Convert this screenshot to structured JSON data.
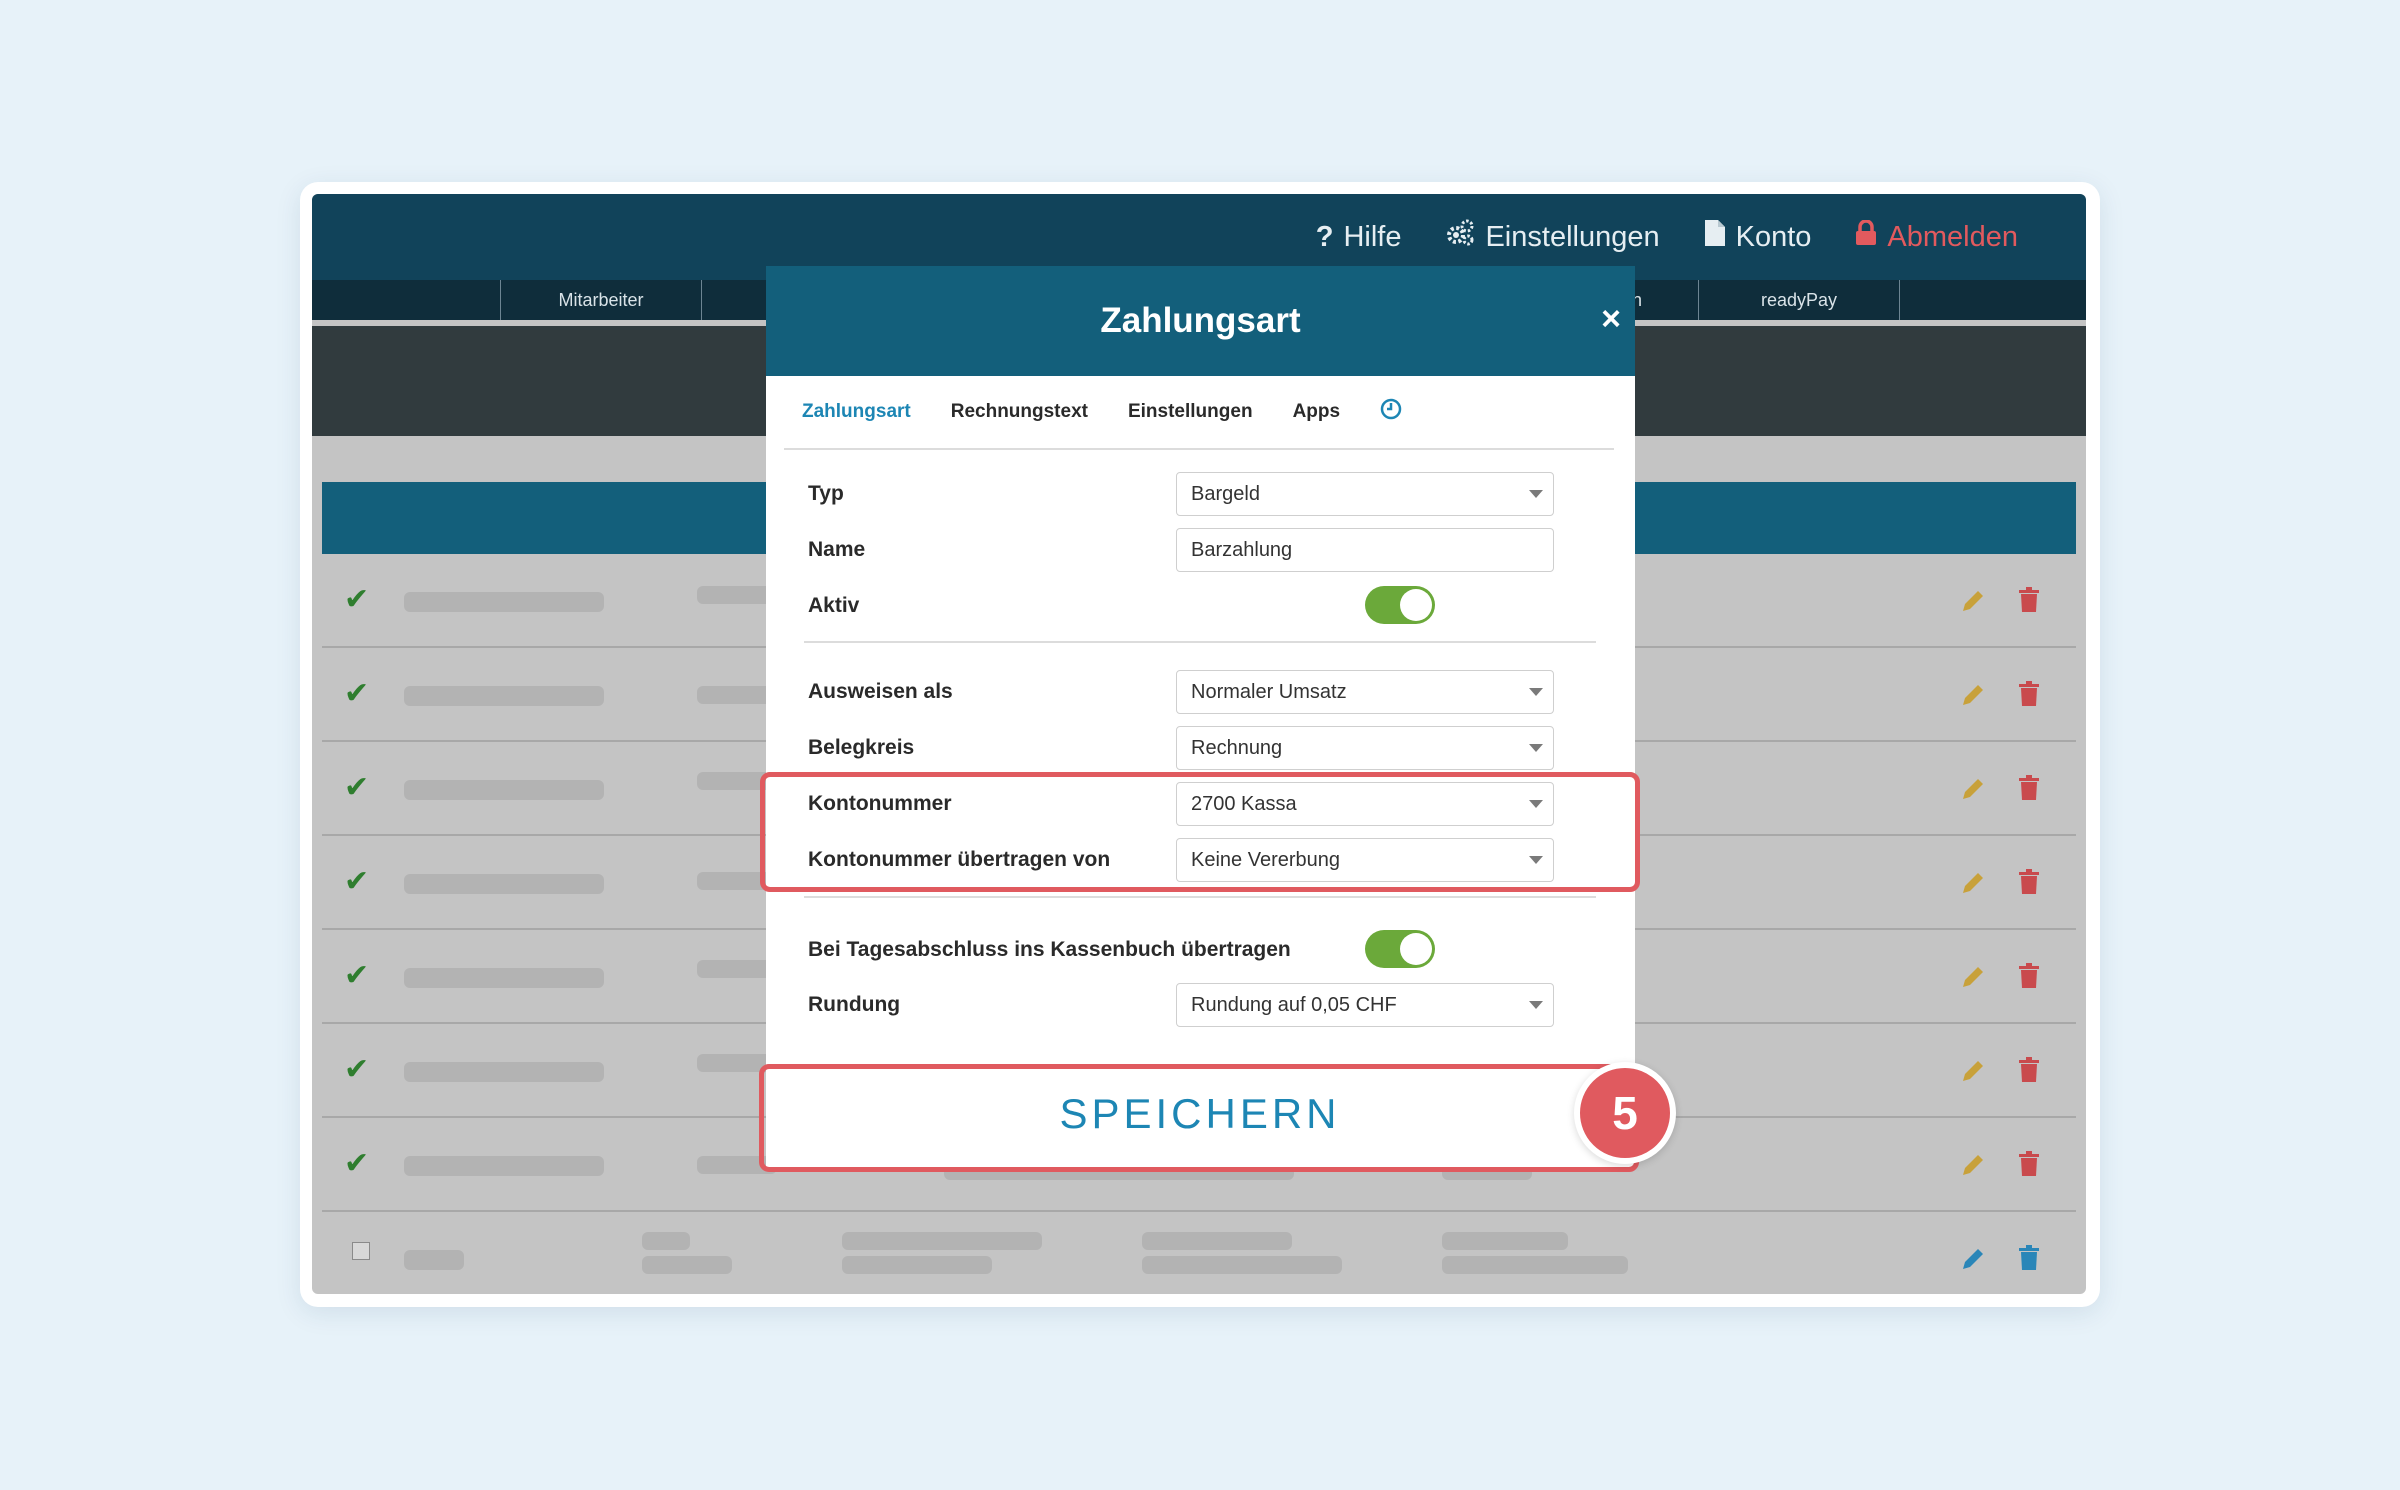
{
  "topnav": {
    "help": "Hilfe",
    "settings": "Einstellungen",
    "account": "Konto",
    "logout": "Abmelden"
  },
  "menubar": {
    "tab_employees": "Mitarbeiter",
    "tab_partial": "en",
    "tab_readypay": "readyPay"
  },
  "modal": {
    "title": "Zahlungsart",
    "close": "×",
    "tabs": [
      "Zahlungsart",
      "Rechnungstext",
      "Einstellungen",
      "Apps"
    ],
    "clock_icon": "clock-icon",
    "fields": {
      "typ_label": "Typ",
      "typ_value": "Bargeld",
      "name_label": "Name",
      "name_value": "Barzahlung",
      "aktiv_label": "Aktiv",
      "aktiv_on": true,
      "ausweisen_label": "Ausweisen als",
      "ausweisen_value": "Normaler Umsatz",
      "belegkreis_label": "Belegkreis",
      "belegkreis_value": "Rechnung",
      "konto_label": "Kontonummer",
      "konto_value": "2700 Kassa",
      "konto_uebertragen_label": "Kontonummer übertragen von",
      "konto_uebertragen_value": "Keine Vererbung",
      "kassenbuch_label": "Bei Tagesabschluss ins Kassenbuch übertragen",
      "kassenbuch_on": true,
      "rundung_label": "Rundung",
      "rundung_value": "Rundung auf 0,05 CHF"
    },
    "save_label": "SPEICHERN"
  },
  "step_number": "5",
  "colors": {
    "header": "#135f7b",
    "accent": "#1d86b4",
    "highlight": "#e05a5f",
    "toggle_on": "#6ba93a",
    "logout": "#e25a5e"
  }
}
